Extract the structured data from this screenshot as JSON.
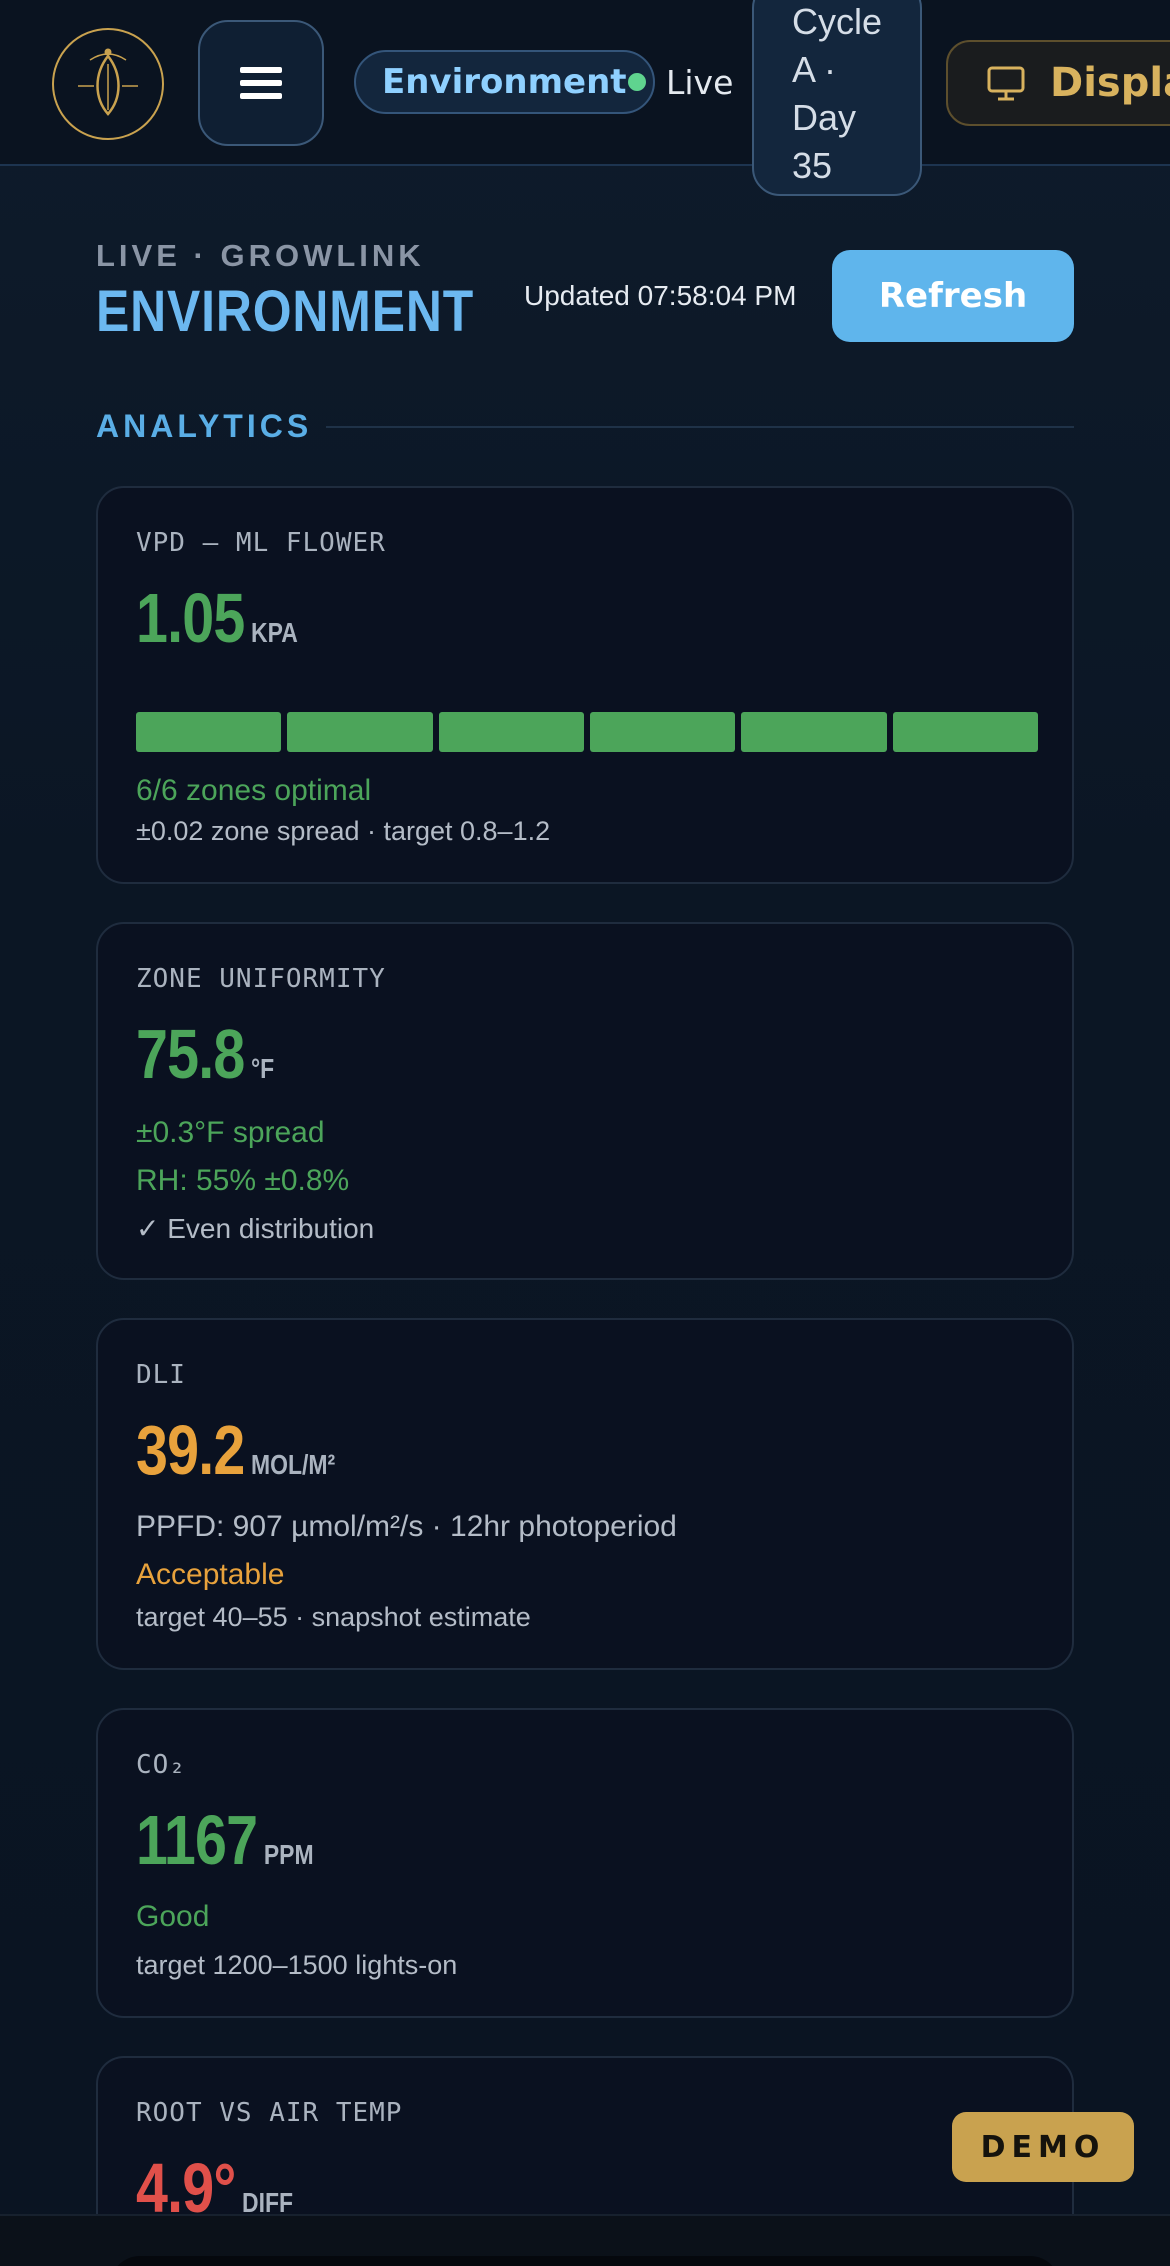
{
  "header": {
    "section_pill": "Environment",
    "live_label": "Live",
    "cycle_lines": [
      "Cycle",
      "A ·",
      "Day",
      "35"
    ],
    "display_label": "Display"
  },
  "page": {
    "kicker": "LIVE · GROWLINK",
    "title": "ENVIRONMENT",
    "updated": "Updated 07:58:04 PM",
    "refresh_label": "Refresh",
    "section_label": "ANALYTICS"
  },
  "cards": {
    "vpd": {
      "label": "VPD — ML FLOWER",
      "value": "1.05",
      "unit": "KPA",
      "zones_optimal": 6,
      "zones_total": 6,
      "status": "6/6 zones optimal",
      "detail": "±0.02 zone spread · target 0.8–1.2"
    },
    "uniformity": {
      "label": "ZONE UNIFORMITY",
      "value": "75.8",
      "unit": "°F",
      "spread": "±0.3°F spread",
      "rh": "RH: 55% ±0.8%",
      "note_check": "✓",
      "note": "Even distribution"
    },
    "dli": {
      "label": "DLI",
      "value": "39.2",
      "unit": "MOL/M²",
      "ppfd": "PPFD: 907 µmol/m²/s · 12hr photoperiod",
      "status": "Acceptable",
      "detail": "target 40–55 · snapshot estimate"
    },
    "co2": {
      "label": "CO₂",
      "value": "1167",
      "unit": "PPM",
      "status": "Good",
      "detail": "target 1200–1500 lights-on"
    },
    "root": {
      "label": "ROOT VS AIR TEMP",
      "value": "4.9°",
      "unit": "DIFF"
    }
  },
  "badge": {
    "demo": "DEMO"
  },
  "colors": {
    "optimal": "#4ca55a",
    "warning": "#e8a23c",
    "alert": "#e0504a",
    "accent": "#5fb5ec",
    "gold": "#c9a24f"
  }
}
